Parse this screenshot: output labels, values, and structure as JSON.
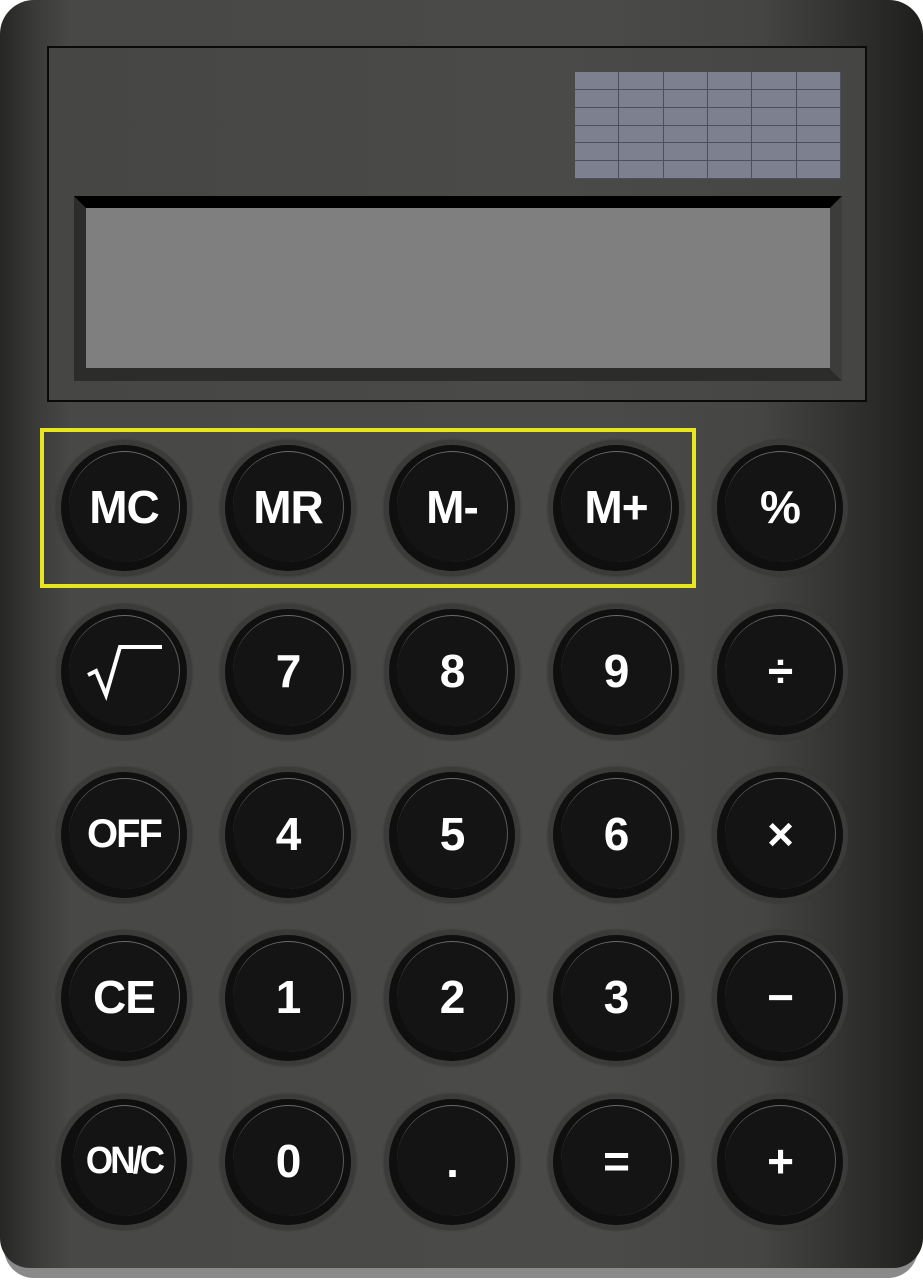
{
  "device": "calculator",
  "display": {
    "value": ""
  },
  "solar_panel": {
    "rows": 6,
    "cols": 6,
    "color": "#7d808f"
  },
  "highlight": {
    "label": "memory-keys-group",
    "color": "#e6e61e"
  },
  "keys": [
    [
      {
        "id": "mc",
        "label": "MC"
      },
      {
        "id": "mr",
        "label": "MR"
      },
      {
        "id": "m-minus",
        "label": "M-"
      },
      {
        "id": "m-plus",
        "label": "M+"
      },
      {
        "id": "percent",
        "label": "%"
      }
    ],
    [
      {
        "id": "sqrt",
        "label": "√"
      },
      {
        "id": "7",
        "label": "7"
      },
      {
        "id": "8",
        "label": "8"
      },
      {
        "id": "9",
        "label": "9"
      },
      {
        "id": "divide",
        "label": "÷"
      }
    ],
    [
      {
        "id": "off",
        "label": "OFF"
      },
      {
        "id": "4",
        "label": "4"
      },
      {
        "id": "5",
        "label": "5"
      },
      {
        "id": "6",
        "label": "6"
      },
      {
        "id": "multiply",
        "label": "×"
      }
    ],
    [
      {
        "id": "ce",
        "label": "CE"
      },
      {
        "id": "1",
        "label": "1"
      },
      {
        "id": "2",
        "label": "2"
      },
      {
        "id": "3",
        "label": "3"
      },
      {
        "id": "subtract",
        "label": "−"
      }
    ],
    [
      {
        "id": "on-c",
        "label": "ON/C"
      },
      {
        "id": "0",
        "label": "0"
      },
      {
        "id": "decimal",
        "label": "."
      },
      {
        "id": "equals",
        "label": "="
      },
      {
        "id": "add",
        "label": "+"
      }
    ]
  ]
}
